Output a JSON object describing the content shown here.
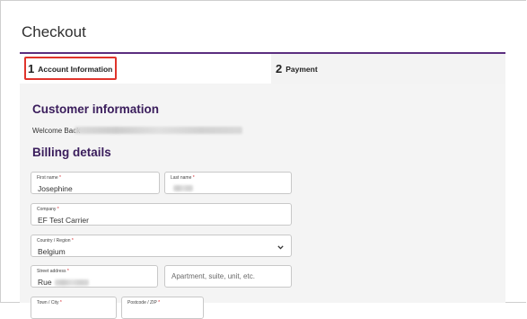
{
  "page": {
    "title": "Checkout"
  },
  "tabs": [
    {
      "number": "1",
      "label": "Account Information"
    },
    {
      "number": "2",
      "label": "Payment"
    }
  ],
  "customer": {
    "heading": "Customer information",
    "welcome": "Welcome Back"
  },
  "billing": {
    "heading": "Billing details",
    "first_name": {
      "label": "First name",
      "required": "*",
      "value": "Josephine"
    },
    "last_name": {
      "label": "Last name",
      "required": "*"
    },
    "company": {
      "label": "Company",
      "required": "*",
      "value": "EF Test Carrier"
    },
    "country": {
      "label": "Country / Region",
      "required": "*",
      "value": "Belgium"
    },
    "street": {
      "label": "Street address",
      "required": "*",
      "value": "Rue"
    },
    "apartment": {
      "placeholder": "Apartment, suite, unit, etc."
    },
    "city": {
      "label": "Town / City",
      "required": "*"
    },
    "postcode": {
      "label": "Postcode / ZIP",
      "required": "*"
    }
  },
  "colors": {
    "accent": "#5b2e7f",
    "heading": "#3a1d5c",
    "highlight": "#e0342c",
    "required": "#d2232a"
  }
}
